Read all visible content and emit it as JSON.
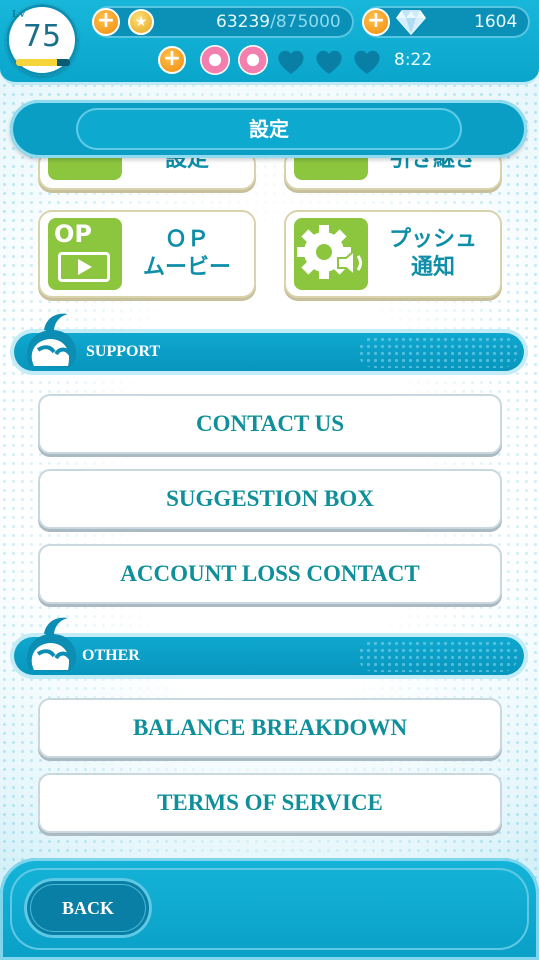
{
  "status": {
    "level_tag": "Lv",
    "level": "75",
    "level_progress": 0.75,
    "coins_current": "63239",
    "coins_max": "/875000",
    "gems": "1604",
    "stamina_full": 2,
    "stamina_total": 5,
    "timer": "8:22"
  },
  "header": {
    "title": "設定"
  },
  "tiles": [
    {
      "label": "設定",
      "icon": "settings-card-icon"
    },
    {
      "label": "引き継ぎ",
      "icon": "phone-transfer-icon"
    },
    {
      "label": "ＯＰ\nムービー",
      "icon": "op-movie-icon",
      "icon_text": "OP"
    },
    {
      "label": "プッシュ\n通知",
      "icon": "gear-speaker-icon"
    }
  ],
  "sections": {
    "support": "SUPPORT",
    "other": "OTHER"
  },
  "support_items": [
    "CONTACT US",
    "SUGGESTION BOX",
    "ACCOUNT LOSS CONTACT"
  ],
  "other_items": [
    "BALANCE BREAKDOWN",
    "TERMS OF SERVICE"
  ],
  "footer": {
    "back_label": "BACK"
  },
  "colors": {
    "accent": "#0aa5cb",
    "button_text": "#0e8f9a",
    "tile_icon_bg": "#8cc63f"
  }
}
